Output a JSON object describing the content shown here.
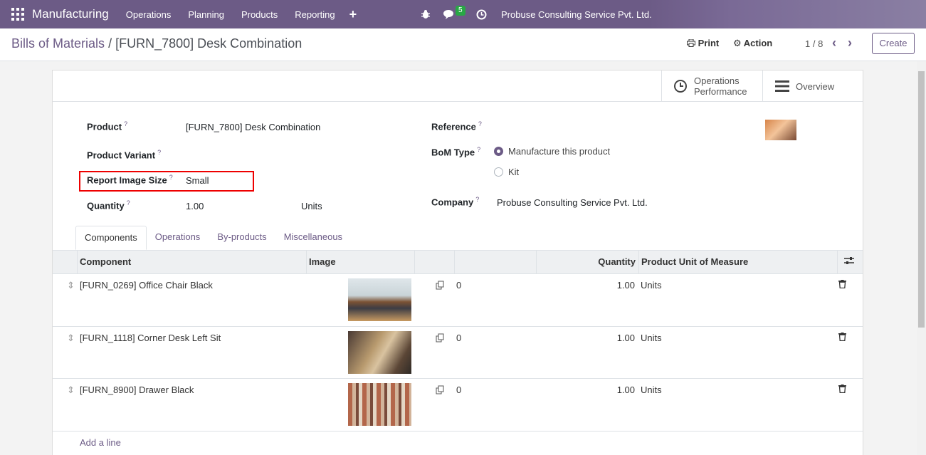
{
  "topbar": {
    "app": "Manufacturing",
    "menus": [
      "Operations",
      "Planning",
      "Products",
      "Reporting"
    ],
    "plus": "+",
    "chat_count": "5",
    "company": "Probuse Consulting Service Pvt. Ltd."
  },
  "breadcrumb": {
    "parent": "Bills of Materials",
    "sep": "/",
    "current": "[FURN_7800] Desk Combination"
  },
  "controls": {
    "print": "Print",
    "action": "Action",
    "pager": "1 / 8",
    "create": "Create"
  },
  "smart_buttons": {
    "ops_line1": "Operations",
    "ops_line2": "Performance",
    "overview": "Overview"
  },
  "form": {
    "product_label": "Product",
    "product": "[FURN_7800] Desk Combination",
    "variant_label": "Product Variant",
    "image_size_label": "Report Image Size",
    "image_size": "Small",
    "qty_label": "Quantity",
    "qty": "1.00",
    "uom": "Units",
    "ref_label": "Reference",
    "bom_type_label": "BoM Type",
    "bom_opt1": "Manufacture this product",
    "bom_opt2": "Kit",
    "company_label": "Company",
    "company": "Probuse Consulting Service Pvt. Ltd.",
    "help": "?"
  },
  "tabs": [
    "Components",
    "Operations",
    "By-products",
    "Miscellaneous"
  ],
  "table": {
    "headers": {
      "component": "Component",
      "image": "Image",
      "quantity": "Quantity",
      "uom": "Product Unit of Measure"
    },
    "rows": [
      {
        "component": "[FURN_0269] Office Chair Black",
        "copy": "0",
        "qty": "1.00",
        "uom": "Units"
      },
      {
        "component": "[FURN_1118] Corner Desk Left Sit",
        "copy": "0",
        "qty": "1.00",
        "uom": "Units"
      },
      {
        "component": "[FURN_8900] Drawer Black",
        "copy": "0",
        "qty": "1.00",
        "uom": "Units"
      }
    ],
    "add_line": "Add a line"
  },
  "colors": {
    "brand": "#6c5b86",
    "highlight": "#e00000"
  }
}
